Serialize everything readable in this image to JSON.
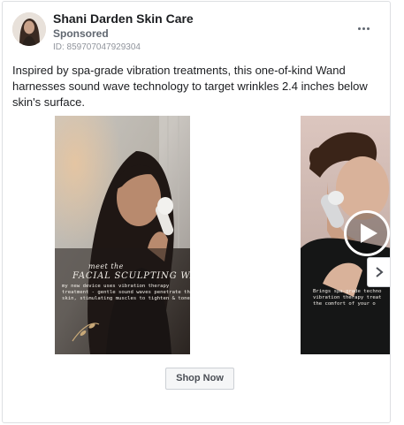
{
  "ad": {
    "page_name": "Shani Darden Skin Care",
    "sponsored_label": "Sponsored",
    "ad_id": "ID: 859707047929304",
    "body_text": "Inspired by spa-grade vibration treatments, this one-of-kind Wand harnesses sound wave technology to target wrinkles 2.4 inches below skin's surface.",
    "cta_label": "Shop Now"
  },
  "icons": {
    "more": "more-options-icon",
    "play": "play-icon",
    "next": "chevron-right-icon"
  },
  "carousel": {
    "slides": [
      {
        "title_small": "meet the",
        "title_big": "FACIAL SCULPTING WAND",
        "caption": "my new device uses vibration therapy\ntreatment - gentle sound waves penetrate the\nskin, stimulating muscles to tighten & tone"
      },
      {
        "caption": "Brings spa-grade techno\nvibration therapy treat\nthe comfort of your o"
      }
    ]
  },
  "colors": {
    "card_border": "#dddfe2",
    "text_primary": "#1c1e21",
    "text_secondary": "#606770",
    "button_bg": "#f5f6f7"
  }
}
